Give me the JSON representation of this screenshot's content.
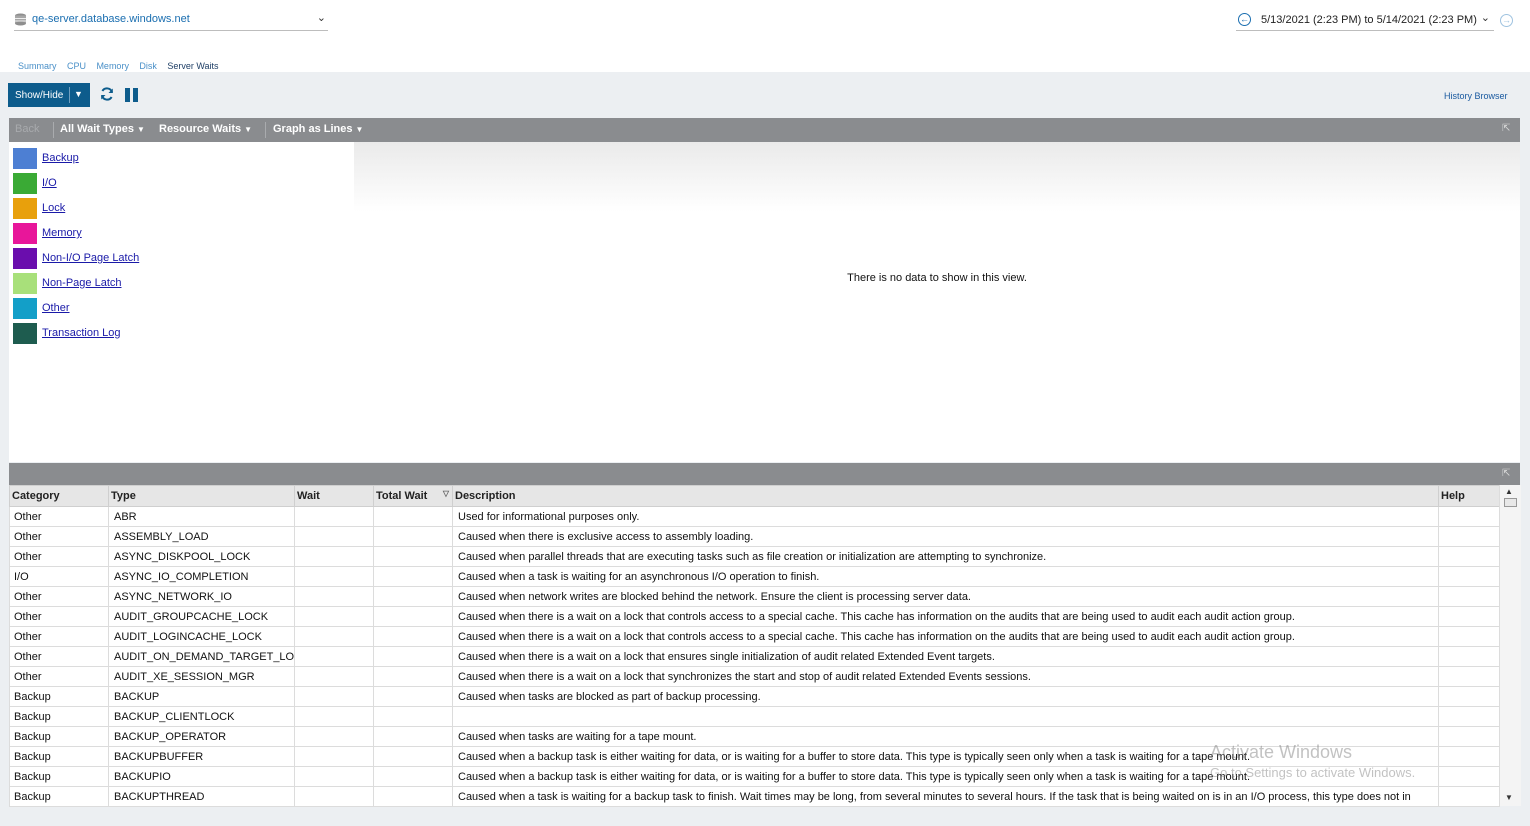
{
  "header": {
    "server_name": "qe-server.database.windows.net",
    "date_range": "5/13/2021 (2:23 PM) to 5/14/2021 (2:23 PM)"
  },
  "tabs": [
    {
      "label": "Summary",
      "active": false
    },
    {
      "label": "CPU",
      "active": false
    },
    {
      "label": "Memory",
      "active": false
    },
    {
      "label": "Disk",
      "active": false
    },
    {
      "label": "Server Waits",
      "active": true
    }
  ],
  "toolbar": {
    "showhide_label": "Show/Hide",
    "history_label": "History Browser"
  },
  "chart_toolbar": {
    "back_label": "Back",
    "wait_types_label": "All Wait Types",
    "resource_waits_label": "Resource Waits",
    "graph_mode_label": "Graph as Lines"
  },
  "legend": [
    {
      "label": "Backup",
      "color": "#4d7fd3"
    },
    {
      "label": "I/O",
      "color": "#3aaa35"
    },
    {
      "label": "Lock",
      "color": "#e8a00c"
    },
    {
      "label": "Memory",
      "color": "#e8169a"
    },
    {
      "label": "Non-I/O Page Latch",
      "color": "#6a0dad"
    },
    {
      "label": "Non-Page Latch",
      "color": "#a8e07a"
    },
    {
      "label": "Other",
      "color": "#139fc8"
    },
    {
      "label": "Transaction Log",
      "color": "#1e5c4f"
    }
  ],
  "chart": {
    "no_data_text": "There is no data to show in this view."
  },
  "grid": {
    "columns": [
      "Category",
      "Type",
      "Wait",
      "Total Wait",
      "Description",
      "Help"
    ],
    "rows": [
      {
        "category": "Other",
        "type": "ABR",
        "wait": "",
        "total_wait": "",
        "description": "Used for informational purposes only.",
        "help": ""
      },
      {
        "category": "Other",
        "type": "ASSEMBLY_LOAD",
        "wait": "",
        "total_wait": "",
        "description": "Caused when there is exclusive access to assembly loading.",
        "help": ""
      },
      {
        "category": "Other",
        "type": "ASYNC_DISKPOOL_LOCK",
        "wait": "",
        "total_wait": "",
        "description": "Caused when parallel threads that are executing tasks such as file creation or initialization are attempting to synchronize.",
        "help": ""
      },
      {
        "category": "I/O",
        "type": "ASYNC_IO_COMPLETION",
        "wait": "",
        "total_wait": "",
        "description": "Caused when a task is waiting for an asynchronous I/O operation to finish.",
        "help": ""
      },
      {
        "category": "Other",
        "type": "ASYNC_NETWORK_IO",
        "wait": "",
        "total_wait": "",
        "description": "Caused when network writes are blocked behind the network. Ensure the client is processing server data.",
        "help": ""
      },
      {
        "category": "Other",
        "type": "AUDIT_GROUPCACHE_LOCK",
        "wait": "",
        "total_wait": "",
        "description": "Caused when there is a wait on a lock that controls access to a special cache. This cache has information on the audits that are being used to audit each audit action group.",
        "help": ""
      },
      {
        "category": "Other",
        "type": "AUDIT_LOGINCACHE_LOCK",
        "wait": "",
        "total_wait": "",
        "description": "Caused when there is a wait on a lock that controls access to a special cache.  This cache has information on the audits that are being used to audit each audit action group.",
        "help": ""
      },
      {
        "category": "Other",
        "type": "AUDIT_ON_DEMAND_TARGET_LOC",
        "wait": "",
        "total_wait": "",
        "description": "Caused when there is a wait on a lock that ensures single initialization of audit related Extended Event targets.",
        "help": ""
      },
      {
        "category": "Other",
        "type": "AUDIT_XE_SESSION_MGR",
        "wait": "",
        "total_wait": "",
        "description": "Caused when there is a wait on a lock that synchronizes the start and stop of audit related Extended Events sessions.",
        "help": ""
      },
      {
        "category": "Backup",
        "type": "BACKUP",
        "wait": "",
        "total_wait": "",
        "description": "Caused when tasks are blocked as part of backup processing.",
        "help": ""
      },
      {
        "category": "Backup",
        "type": "BACKUP_CLIENTLOCK",
        "wait": "",
        "total_wait": "",
        "description": "",
        "help": ""
      },
      {
        "category": "Backup",
        "type": "BACKUP_OPERATOR",
        "wait": "",
        "total_wait": "",
        "description": "Caused when tasks are waiting for a tape mount.",
        "help": ""
      },
      {
        "category": "Backup",
        "type": "BACKUPBUFFER",
        "wait": "",
        "total_wait": "",
        "description": "Caused when a backup task is either waiting for data, or is waiting for a buffer to store data. This type is typically seen only when a task is waiting for a tape mount.",
        "help": ""
      },
      {
        "category": "Backup",
        "type": "BACKUPIO",
        "wait": "",
        "total_wait": "",
        "description": "Caused when a backup task is either waiting for data, or is waiting for a buffer to store data. This type is typically seen only when a task is waiting for a tape mount.",
        "help": ""
      },
      {
        "category": "Backup",
        "type": "BACKUPTHREAD",
        "wait": "",
        "total_wait": "",
        "description": "Caused when a task is waiting for a backup task to finish. Wait times may be long, from several minutes to several hours. If the task that is being waited on is in an I/O process, this type does not in",
        "help": ""
      }
    ]
  },
  "watermark": {
    "line1": "Activate Windows",
    "line2": "Go to Settings to activate Windows."
  }
}
